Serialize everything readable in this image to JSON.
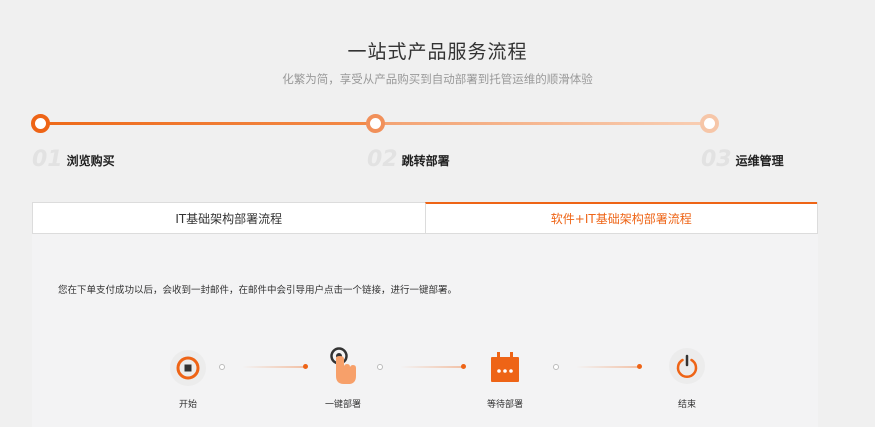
{
  "header": {
    "title": "一站式产品服务流程",
    "subtitle": "化繁为简，享受从产品购买到自动部署到托管运维的顺滑体验"
  },
  "steps": [
    {
      "num": "01",
      "label": "浏览购买"
    },
    {
      "num": "02",
      "label": "跳转部署"
    },
    {
      "num": "03",
      "label": "运维管理"
    }
  ],
  "tabs": [
    {
      "label": "IT基础架构部署流程",
      "active": false
    },
    {
      "label": "软件+IT基础架构部署流程",
      "active": true
    }
  ],
  "panel": {
    "description": "您在下单支付成功以后，会收到一封邮件，在邮件中会引导用户点击一个链接，进行一键部署。",
    "flow": [
      {
        "label": "开始",
        "icon": "start-icon"
      },
      {
        "label": "一键部署",
        "icon": "click-hand-icon"
      },
      {
        "label": "等待部署",
        "icon": "calendar-icon"
      },
      {
        "label": "结束",
        "icon": "power-icon"
      }
    ]
  },
  "colors": {
    "accent": "#ee6416",
    "background": "#f0f0f0",
    "panel": "#f3f3f4"
  }
}
